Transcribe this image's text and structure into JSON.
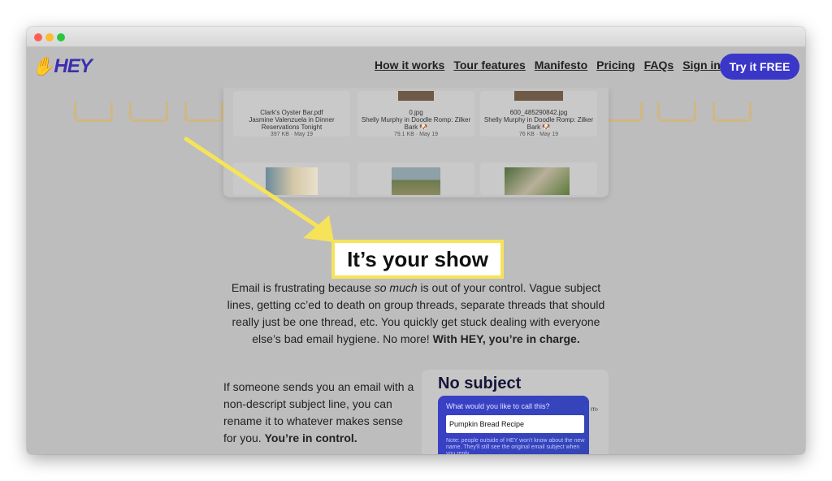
{
  "nav": {
    "logo": "HEY",
    "links": [
      "How it works",
      "Tour features",
      "Manifesto",
      "Pricing",
      "FAQs",
      "Sign in"
    ],
    "cta": "Try it FREE"
  },
  "attachments": [
    {
      "filename": "Clark's Oyster Bar.pdf",
      "line1": "Jasmine Valenzuela in Dinner",
      "line2": "Reservations Tonight",
      "meta": "397 KB · May 19"
    },
    {
      "filename": "0.jpg",
      "line1": "Shelly Murphy in Doodle Romp: Zilker",
      "line2": "Bark 🐶",
      "meta": "79.1 KB · May 19"
    },
    {
      "filename": "600_485290842.jpg",
      "line1": "Shelly Murphy in Doodle Romp: Zilker",
      "line2": "Bark 🐶",
      "meta": "76 KB · May 19"
    }
  ],
  "section": {
    "heading": "It’s your show",
    "intro_a": "Email is frustrating because ",
    "intro_em": "so much",
    "intro_b": " is out of your control. Vague subject lines, getting cc’ed to death on group threads, separate threads that should really just be one thread, etc. You quickly get stuck dealing with everyone else’s bad email hygiene. No more! ",
    "intro_strong": "With HEY, you’re in charge."
  },
  "feature": {
    "text": "If someone sends you an email with a non-descript subject line, you can rename it to whatever makes sense for you. ",
    "text_strong": "You’re in control."
  },
  "no_subject": {
    "title": "No subject",
    "prompt": "What would you like to call this?",
    "input_value": "Pumpkin Bread Recipe",
    "note": "Note: people outside of HEY won't know about the new name. They'll still see the original email subject when you reply.",
    "peek": "m›"
  },
  "colors": {
    "brand": "#3a36c7",
    "highlight": "#f6e35a"
  }
}
